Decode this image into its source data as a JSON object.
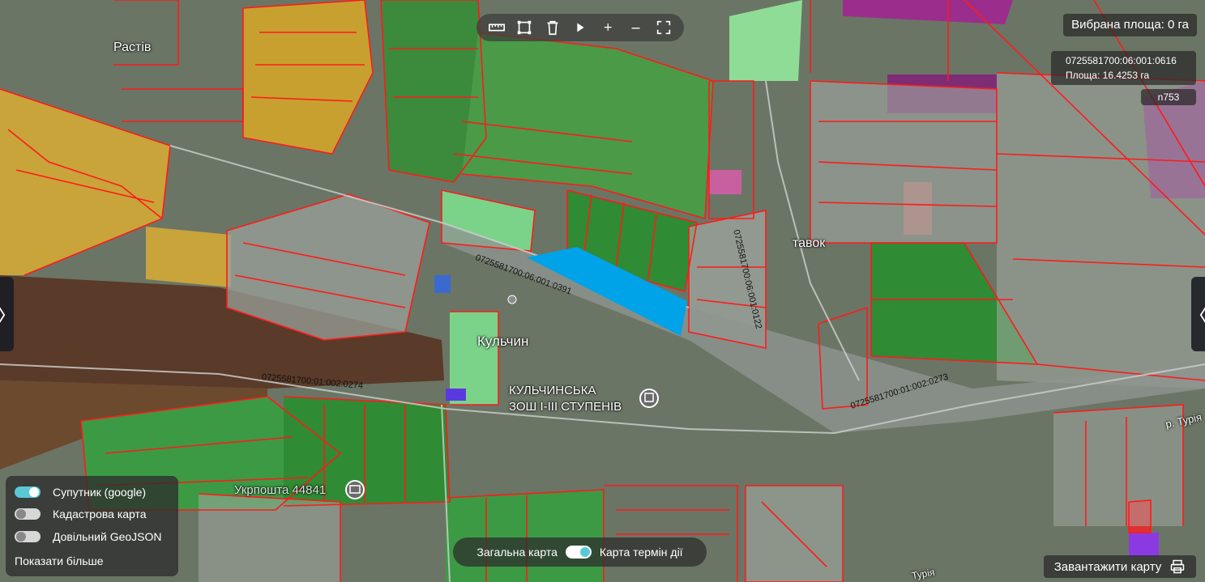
{
  "map": {
    "labels": {
      "town_rastiv": "Растів",
      "town_kulchyn": "Кульчин",
      "town_stavok": "тавок",
      "school_line1": "КУЛЬЧИНСЬКА",
      "school_line2": "ЗОШ І-ІІІ СТУПЕНІВ",
      "post_office": "Укрпошта 44841",
      "river_turiya": "р. Турія",
      "river_turiya_bottom": "Турія"
    },
    "parcel_codes": {
      "road_top": "0725581700:06:001:0391",
      "road_left": "0725581700:01:002:0274",
      "road_right": "0725581700:01:002:0273",
      "vertical": "0725581700:06:001:0122"
    },
    "highlight_color": "#00a3e8",
    "parcel_outline_color": "#ff1a1a"
  },
  "toolbar": {
    "ruler_icon": "ruler-icon",
    "polygon_icon": "polygon-select-icon",
    "trash_icon": "trash-icon",
    "pointer_icon": "pointer-icon",
    "zoom_in_label": "+",
    "zoom_out_label": "−",
    "fullscreen_icon": "fullscreen-icon"
  },
  "selected_area": {
    "label": "Вибрана площа: 0 га"
  },
  "parcel_info": {
    "cadastre": "0725581700:06:001:0616",
    "area": "Площа: 16.4253 га",
    "id": "n753"
  },
  "side_tabs": {
    "left_glyph": "〉",
    "right_glyph": "〈"
  },
  "layers": {
    "items": [
      {
        "label": "Супутник (google)",
        "on": true
      },
      {
        "label": "Кадастрова карта",
        "on": false
      },
      {
        "label": "Довільний GeoJSON",
        "on": false
      }
    ],
    "show_more": "Показати більше"
  },
  "map_mode": {
    "left_label": "Загальна карта",
    "right_label": "Карта термін дії"
  },
  "download": {
    "label": "Завантажити карту",
    "icon": "printer-icon"
  }
}
